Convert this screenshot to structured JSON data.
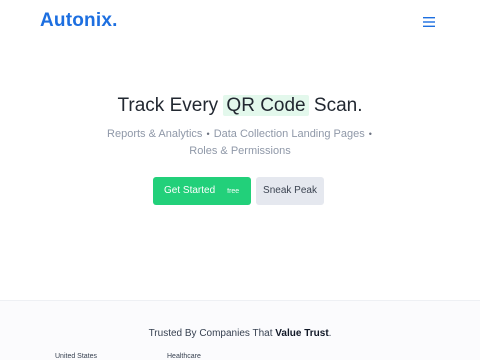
{
  "header": {
    "logo": "Autonix.",
    "menu_icon": "hamburger-menu-icon",
    "brand_color": "#1d6fe0"
  },
  "hero": {
    "headline_prefix": "Track Every",
    "headline_highlight": "QR Code",
    "headline_suffix": "Scan.",
    "features": [
      "Reports & Analytics",
      "Data Collection Landing Pages",
      "Roles & Permissions"
    ],
    "feature_separator": "•",
    "primary_button": {
      "label": "Get Started",
      "tag": "free",
      "color": "#22d07a"
    },
    "secondary_button": {
      "label": "Sneak Peak"
    }
  },
  "trusted": {
    "prefix": "Trusted By Companies That",
    "emphasis": "Value Trust",
    "suffix": ".",
    "companies": [
      {
        "label": "United States"
      },
      {
        "label": "Healthcare"
      }
    ]
  }
}
